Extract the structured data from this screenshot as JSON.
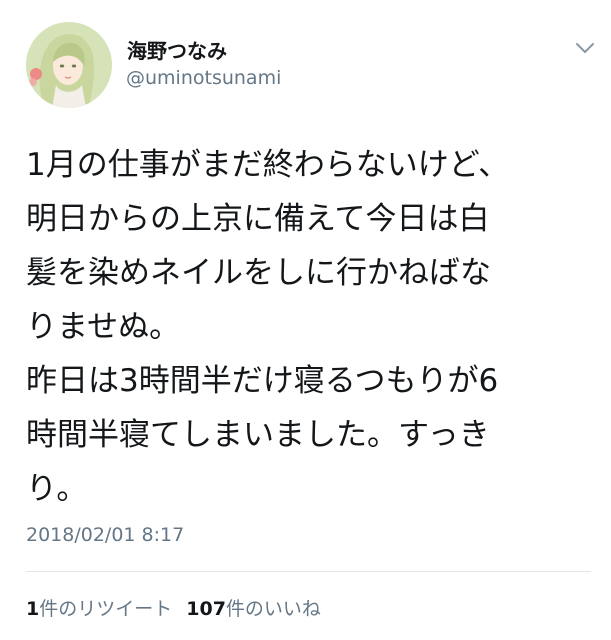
{
  "user": {
    "display_name": "海野つなみ",
    "handle": "@uminotsunami"
  },
  "icons": {
    "menu": "chevron-down-icon",
    "avatar": "illustrated-portrait"
  },
  "tweet": {
    "text": "1月の仕事がまだ終わらないけど、\n明日からの上京に備えて今日は白\n髪を染めネイルをしに行かねばな\nりませぬ。\n昨日は3時間半だけ寝るつもりが6\n時間半寝てしまいました。すっき\nり。",
    "timestamp": "2018/02/01 8:17"
  },
  "stats": {
    "retweet_count": "1",
    "retweet_label": "件のリツイート",
    "like_count": "107",
    "like_label": "件のいいね"
  },
  "colors": {
    "text": "#14171a",
    "secondary": "#657786",
    "divider": "#e1e8ed"
  }
}
